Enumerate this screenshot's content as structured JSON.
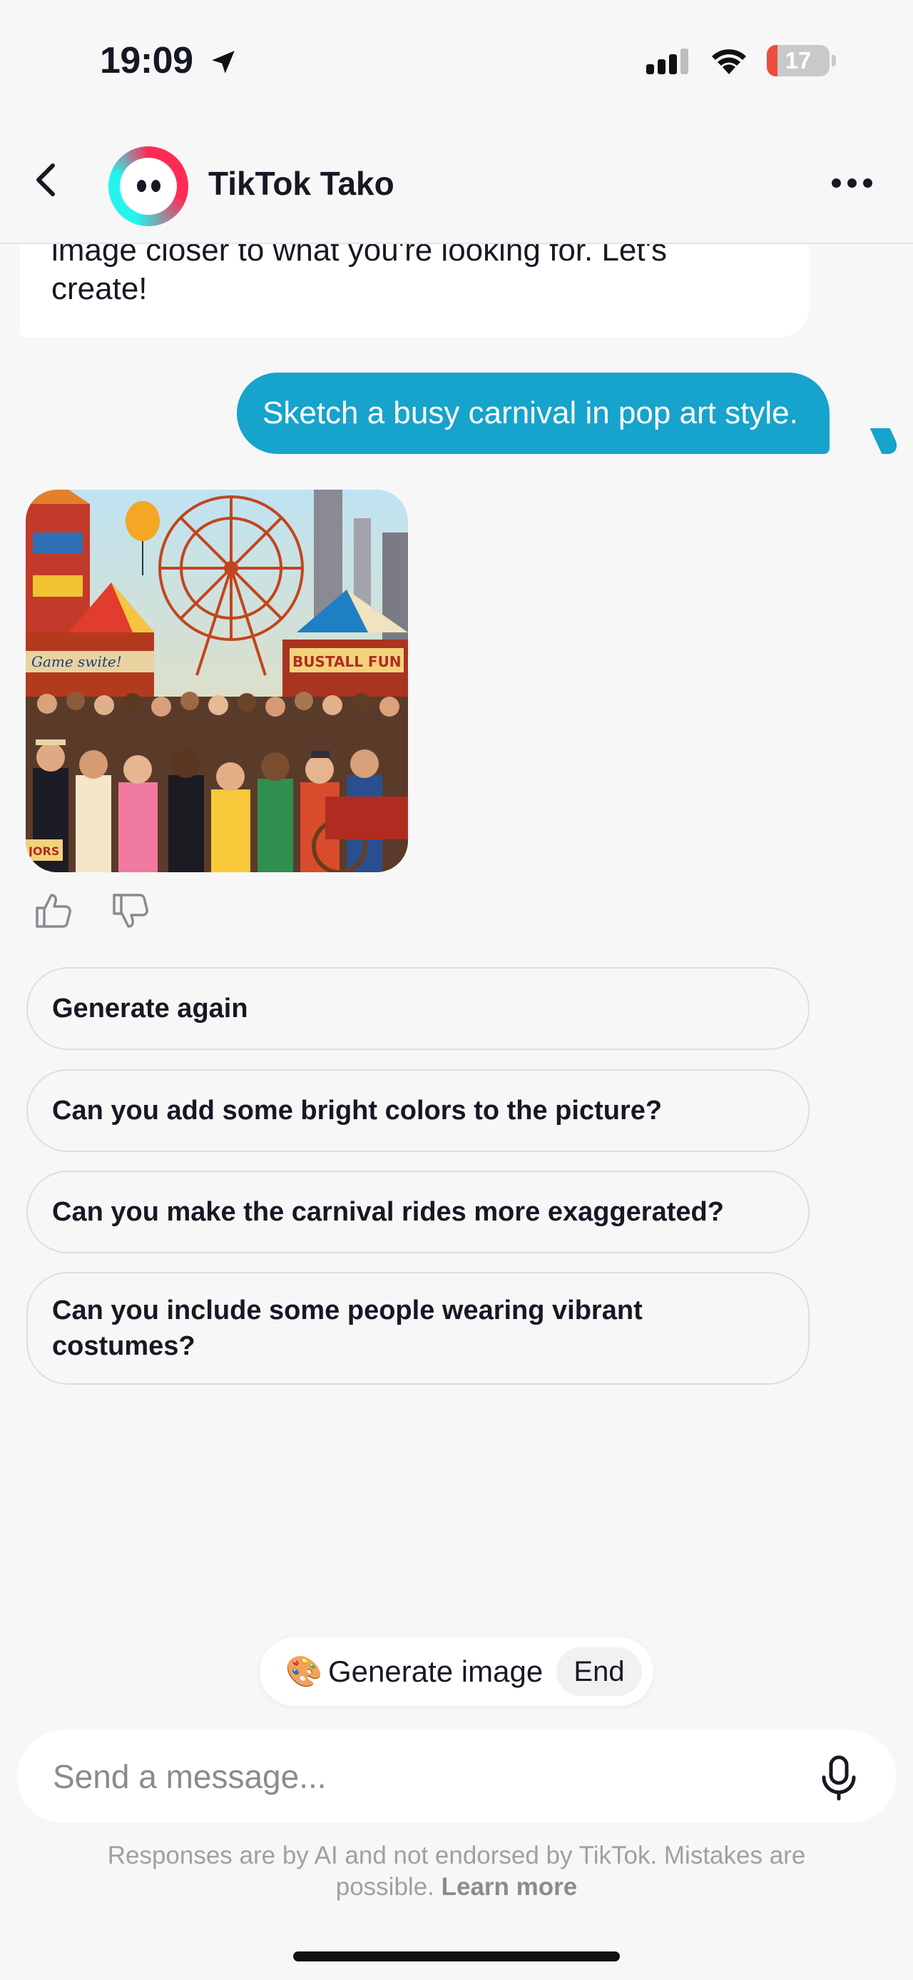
{
  "status_bar": {
    "time": "19:09",
    "battery": "17",
    "battery_level_percent": 17,
    "icons": [
      "location-arrow-icon",
      "cellular-signal-icon",
      "wifi-icon",
      "battery-icon"
    ]
  },
  "header": {
    "title": "TikTok Tako",
    "back_icon": "chevron-left-icon",
    "more_icon": "more-horizontal-icon"
  },
  "messages": {
    "bot_partial_line1": "image closer to what you're looking for. Let's",
    "bot_partial_line2": "create!",
    "user_prompt": "Sketch a busy carnival in pop art style."
  },
  "feedback": {
    "like_icon": "thumbs-up-icon",
    "dislike_icon": "thumbs-down-icon"
  },
  "suggestions": [
    {
      "label": "Generate again"
    },
    {
      "label": "Can you add some bright colors to the picture?"
    },
    {
      "label": "Can you make the carnival rides more exaggerated?"
    },
    {
      "label": "Can you include some people wearing vibrant costumes?"
    }
  ],
  "image_signs": {
    "left": "Game swite!",
    "right": "BUSTALL FUN",
    "bottom": "JORS"
  },
  "generate_pill": {
    "icon": "🎨",
    "label": "Generate image",
    "end_label": "End"
  },
  "input": {
    "placeholder": "Send a message...",
    "mic_icon": "microphone-icon"
  },
  "disclaimer": {
    "text": "Responses are by AI and not endorsed by TikTok. Mistakes are possible.",
    "link": "Learn more"
  },
  "colors": {
    "user_bubble": "#16a3cc",
    "background": "#f7f7f7",
    "battery_low": "#eb4e3d"
  }
}
